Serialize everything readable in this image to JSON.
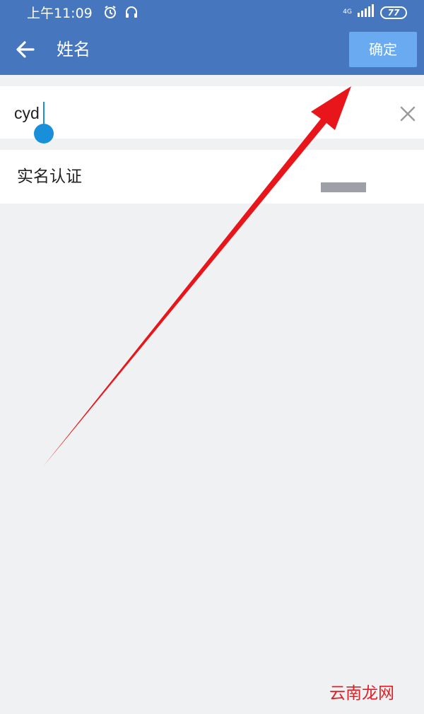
{
  "status_bar": {
    "time": "上午11:09",
    "icons": [
      "alarm-icon",
      "headset-icon"
    ],
    "network": "4G",
    "battery": "77"
  },
  "app_bar": {
    "back_icon": "arrow-left-icon",
    "title": "姓名",
    "confirm_label": "确定",
    "background": "#4677be",
    "confirm_background": "#69aaf0"
  },
  "name_field": {
    "value": "cyd",
    "clear_icon": "close-icon",
    "cursor_color": "#1a8fd9"
  },
  "verify_row": {
    "label": "实名认证"
  },
  "annotation": {
    "arrow_icon": "red-arrow-icon",
    "color": "#e8161b"
  },
  "watermark": "云南龙网"
}
